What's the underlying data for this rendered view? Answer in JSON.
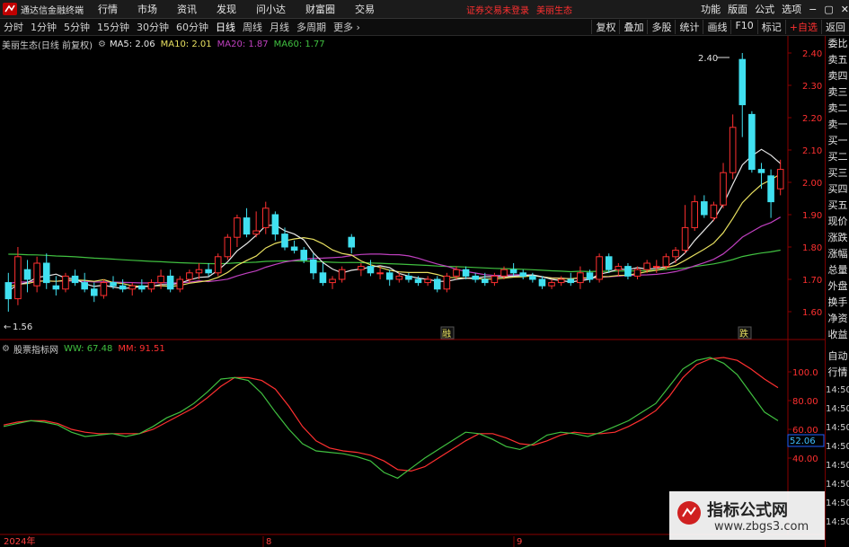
{
  "menubar": {
    "app_title": "通达信金融终端",
    "menu": [
      "行情",
      "市场",
      "资讯",
      "发现",
      "问小达",
      "财富圈",
      "交易"
    ],
    "notice": "证券交易未登录",
    "stock_name": "美丽生态",
    "right": [
      "功能",
      "版面",
      "公式",
      "选项"
    ],
    "window_controls": [
      "−",
      "▢",
      "✕"
    ]
  },
  "periodbar": {
    "periods": [
      "分时",
      "1分钟",
      "5分钟",
      "15分钟",
      "30分钟",
      "60分钟",
      "日线",
      "周线",
      "月线",
      "多周期",
      "更多 ›"
    ],
    "active": "日线",
    "right": [
      "复权",
      "叠加",
      "多股",
      "统计",
      "画线",
      "F10",
      "标记",
      "+自选",
      "返回"
    ]
  },
  "price_legend": {
    "title": "美丽生态(日线 前复权)",
    "ma": [
      {
        "label": "MA5: 2.06",
        "color": "#e8e8e8"
      },
      {
        "label": "MA10: 2.01",
        "color": "#e8e060"
      },
      {
        "label": "MA20: 1.87",
        "color": "#c040c0"
      },
      {
        "label": "MA60: 1.77",
        "color": "#40c040"
      }
    ]
  },
  "indicator_legend": {
    "title": "股票指标网",
    "items": [
      {
        "label": "WW: 67.48",
        "color": "#40c040"
      },
      {
        "label": "MM: 91.51",
        "color": "#ff3030"
      }
    ]
  },
  "price_axis": {
    "labels": [
      "2.40",
      "2.30",
      "2.20",
      "2.10",
      "2.00",
      "1.90",
      "1.80",
      "1.70",
      "1.60"
    ],
    "min": 1.55,
    "max": 2.45
  },
  "price_marks": {
    "high": "2.40",
    "low": "1.56"
  },
  "candle_badges": [
    "融",
    "跌"
  ],
  "indicator_axis": {
    "labels": [
      "100.0",
      "80.00",
      "60.00",
      "40.00"
    ],
    "current": "52.06",
    "min": 30,
    "max": 115
  },
  "date_axis": [
    "2024年",
    "8",
    "9"
  ],
  "side_panel": {
    "top": [
      "委比",
      "卖五",
      "卖四",
      "卖三",
      "卖二",
      "卖一",
      "买一",
      "买二",
      "买三",
      "买四",
      "买五",
      "现价",
      "涨跌",
      "涨幅",
      "总量",
      "外盘",
      "换手",
      "净资",
      "收益"
    ],
    "bottom": [
      "自动",
      "行情"
    ],
    "times": [
      "14:50",
      "14:50",
      "14:50",
      "14:50",
      "14:50",
      "14:50",
      "14:50",
      "14:50",
      "14:50"
    ]
  },
  "watermark": {
    "line1": "指标公式网",
    "line2": "www.zbgs3.com"
  },
  "colors": {
    "up": "#ff3030",
    "down": "#40e0f0",
    "ma5": "#e8e8e8",
    "ma10": "#e8e060",
    "ma20": "#c040c0",
    "ma60": "#40c040",
    "ww": "#40c040",
    "mm": "#ff3030"
  },
  "chart_data": [
    {
      "type": "candlestick",
      "title": "美丽生态(日线 前复权)",
      "ylim": [
        1.55,
        2.45
      ],
      "ohlc": [
        [
          1.69,
          1.72,
          1.6,
          1.64
        ],
        [
          1.64,
          1.8,
          1.62,
          1.77
        ],
        [
          1.73,
          1.76,
          1.66,
          1.7
        ],
        [
          1.68,
          1.77,
          1.66,
          1.75
        ],
        [
          1.75,
          1.78,
          1.67,
          1.69
        ],
        [
          1.68,
          1.71,
          1.65,
          1.67
        ],
        [
          1.67,
          1.72,
          1.66,
          1.71
        ],
        [
          1.71,
          1.73,
          1.68,
          1.69
        ],
        [
          1.69,
          1.72,
          1.66,
          1.67
        ],
        [
          1.67,
          1.69,
          1.63,
          1.65
        ],
        [
          1.65,
          1.7,
          1.64,
          1.69
        ],
        [
          1.69,
          1.71,
          1.67,
          1.68
        ],
        [
          1.68,
          1.7,
          1.66,
          1.67
        ],
        [
          1.67,
          1.69,
          1.65,
          1.68
        ],
        [
          1.68,
          1.7,
          1.66,
          1.67
        ],
        [
          1.67,
          1.7,
          1.66,
          1.69
        ],
        [
          1.69,
          1.73,
          1.67,
          1.71
        ],
        [
          1.71,
          1.73,
          1.66,
          1.67
        ],
        [
          1.67,
          1.71,
          1.66,
          1.7
        ],
        [
          1.7,
          1.73,
          1.69,
          1.72
        ],
        [
          1.72,
          1.75,
          1.7,
          1.73
        ],
        [
          1.73,
          1.75,
          1.71,
          1.72
        ],
        [
          1.72,
          1.78,
          1.71,
          1.77
        ],
        [
          1.77,
          1.84,
          1.76,
          1.83
        ],
        [
          1.83,
          1.9,
          1.8,
          1.89
        ],
        [
          1.89,
          1.92,
          1.83,
          1.84
        ],
        [
          1.84,
          1.91,
          1.83,
          1.85
        ],
        [
          1.86,
          1.94,
          1.84,
          1.92
        ],
        [
          1.9,
          1.91,
          1.82,
          1.84
        ],
        [
          1.84,
          1.86,
          1.79,
          1.8
        ],
        [
          1.8,
          1.82,
          1.78,
          1.79
        ],
        [
          1.79,
          1.8,
          1.75,
          1.76
        ],
        [
          1.76,
          1.78,
          1.7,
          1.72
        ],
        [
          1.72,
          1.75,
          1.68,
          1.69
        ],
        [
          1.69,
          1.71,
          1.67,
          1.7
        ],
        [
          1.7,
          1.74,
          1.69,
          1.73
        ],
        [
          1.83,
          1.84,
          1.78,
          1.8
        ],
        [
          1.73,
          1.75,
          1.71,
          1.74
        ],
        [
          1.74,
          1.76,
          1.71,
          1.72
        ],
        [
          1.72,
          1.74,
          1.7,
          1.72
        ],
        [
          1.72,
          1.73,
          1.68,
          1.7
        ],
        [
          1.7,
          1.72,
          1.69,
          1.71
        ],
        [
          1.71,
          1.72,
          1.69,
          1.7
        ],
        [
          1.7,
          1.71,
          1.68,
          1.69
        ],
        [
          1.69,
          1.71,
          1.68,
          1.7
        ],
        [
          1.7,
          1.71,
          1.66,
          1.67
        ],
        [
          1.67,
          1.72,
          1.66,
          1.71
        ],
        [
          1.71,
          1.74,
          1.7,
          1.73
        ],
        [
          1.73,
          1.74,
          1.7,
          1.71
        ],
        [
          1.71,
          1.72,
          1.69,
          1.7
        ],
        [
          1.7,
          1.72,
          1.68,
          1.69
        ],
        [
          1.69,
          1.72,
          1.68,
          1.71
        ],
        [
          1.71,
          1.74,
          1.7,
          1.73
        ],
        [
          1.73,
          1.75,
          1.71,
          1.72
        ],
        [
          1.72,
          1.73,
          1.7,
          1.71
        ],
        [
          1.71,
          1.72,
          1.69,
          1.7
        ],
        [
          1.7,
          1.71,
          1.67,
          1.68
        ],
        [
          1.68,
          1.7,
          1.67,
          1.69
        ],
        [
          1.69,
          1.71,
          1.68,
          1.7
        ],
        [
          1.7,
          1.72,
          1.68,
          1.69
        ],
        [
          1.69,
          1.74,
          1.67,
          1.72
        ],
        [
          1.72,
          1.73,
          1.69,
          1.7
        ],
        [
          1.7,
          1.78,
          1.69,
          1.77
        ],
        [
          1.77,
          1.78,
          1.72,
          1.73
        ],
        [
          1.73,
          1.75,
          1.71,
          1.74
        ],
        [
          1.74,
          1.75,
          1.7,
          1.71
        ],
        [
          1.71,
          1.74,
          1.7,
          1.73
        ],
        [
          1.73,
          1.76,
          1.72,
          1.75
        ],
        [
          1.74,
          1.76,
          1.72,
          1.74
        ],
        [
          1.74,
          1.78,
          1.73,
          1.77
        ],
        [
          1.77,
          1.8,
          1.75,
          1.79
        ],
        [
          1.79,
          1.93,
          1.78,
          1.86
        ],
        [
          1.86,
          1.96,
          1.85,
          1.94
        ],
        [
          1.94,
          1.96,
          1.89,
          1.9
        ],
        [
          1.89,
          1.94,
          1.88,
          1.93
        ],
        [
          1.93,
          2.06,
          1.92,
          2.03
        ],
        [
          2.03,
          2.21,
          2.01,
          2.17
        ],
        [
          2.38,
          2.4,
          2.14,
          2.24
        ],
        [
          2.21,
          2.22,
          2.03,
          2.04
        ],
        [
          2.04,
          2.06,
          1.98,
          2.03
        ],
        [
          2.02,
          2.04,
          1.89,
          1.94
        ],
        [
          1.98,
          2.07,
          1.96,
          2.04
        ]
      ],
      "ma_labels": [
        "MA5: 2.06",
        "MA10: 2.01",
        "MA20: 1.87",
        "MA60: 1.77"
      ]
    },
    {
      "type": "line",
      "title": "股票指标网",
      "ylim": [
        30,
        115
      ],
      "series": [
        {
          "name": "WW",
          "values": [
            62,
            64,
            66,
            65,
            63,
            58,
            55,
            56,
            57,
            55,
            57,
            62,
            68,
            72,
            78,
            86,
            95,
            96,
            94,
            85,
            72,
            60,
            50,
            45,
            44,
            43,
            41,
            38,
            30,
            26,
            33,
            40,
            46,
            52,
            58,
            57,
            53,
            48,
            46,
            50,
            56,
            58,
            57,
            55,
            58,
            62,
            66,
            72,
            78,
            90,
            102,
            108,
            110,
            106,
            98,
            85,
            72,
            66
          ]
        },
        {
          "name": "MM",
          "values": [
            63,
            65,
            66,
            66,
            64,
            60,
            58,
            57,
            57,
            57,
            57,
            60,
            65,
            70,
            75,
            82,
            90,
            96,
            96,
            94,
            88,
            76,
            62,
            52,
            47,
            45,
            44,
            42,
            38,
            32,
            31,
            34,
            40,
            46,
            52,
            57,
            57,
            54,
            50,
            49,
            52,
            56,
            58,
            57,
            57,
            58,
            62,
            67,
            73,
            83,
            96,
            105,
            109,
            110,
            108,
            102,
            95,
            89
          ]
        }
      ]
    }
  ]
}
